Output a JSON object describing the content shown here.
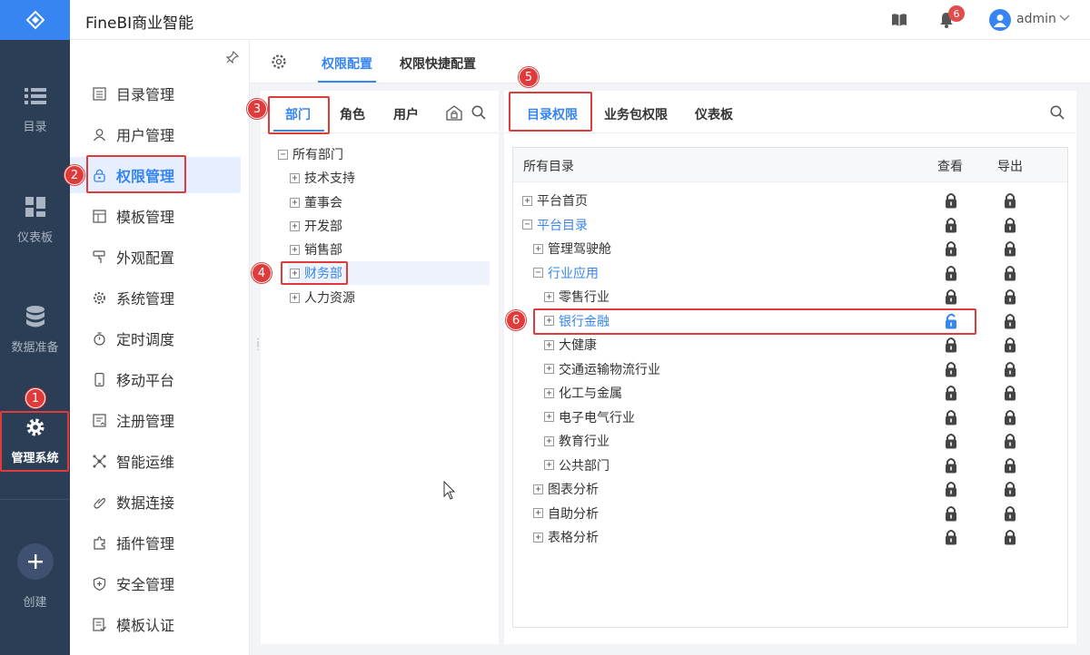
{
  "app": {
    "title": "FineBI商业智能",
    "user": "admin",
    "notification_count": "6"
  },
  "rail": {
    "items": [
      {
        "label": "目录",
        "icon": "list-icon"
      },
      {
        "label": "仪表板",
        "icon": "dashboard-icon"
      },
      {
        "label": "数据准备",
        "icon": "database-icon"
      },
      {
        "label": "管理系统",
        "icon": "gear-icon",
        "active": true
      },
      {
        "label": "创建",
        "icon": "plus-icon"
      }
    ]
  },
  "menu": {
    "items": [
      {
        "label": "目录管理",
        "icon": "catalog-icon"
      },
      {
        "label": "用户管理",
        "icon": "user-icon"
      },
      {
        "label": "权限管理",
        "icon": "lock-icon",
        "active": true
      },
      {
        "label": "模板管理",
        "icon": "template-icon"
      },
      {
        "label": "外观配置",
        "icon": "brush-icon"
      },
      {
        "label": "系统管理",
        "icon": "settings-icon"
      },
      {
        "label": "定时调度",
        "icon": "timer-icon"
      },
      {
        "label": "移动平台",
        "icon": "mobile-icon"
      },
      {
        "label": "注册管理",
        "icon": "register-icon"
      },
      {
        "label": "智能运维",
        "icon": "ops-icon"
      },
      {
        "label": "数据连接",
        "icon": "link-icon"
      },
      {
        "label": "插件管理",
        "icon": "plugin-icon"
      },
      {
        "label": "安全管理",
        "icon": "shield-icon"
      },
      {
        "label": "模板认证",
        "icon": "certify-icon"
      }
    ]
  },
  "main_tabs": [
    "权限配置",
    "权限快捷配置"
  ],
  "left_tabs": [
    "部门",
    "角色",
    "用户"
  ],
  "dept_tree": [
    {
      "label": "所有部门",
      "sign": "−"
    },
    {
      "label": "技术支持",
      "sign": "+"
    },
    {
      "label": "董事会",
      "sign": "+"
    },
    {
      "label": "开发部",
      "sign": "+"
    },
    {
      "label": "销售部",
      "sign": "+"
    },
    {
      "label": "财务部",
      "sign": "+"
    },
    {
      "label": "人力资源",
      "sign": "+"
    }
  ],
  "right_tabs": [
    "目录权限",
    "业务包权限",
    "仪表板"
  ],
  "catalog": {
    "header": {
      "name": "所有目录",
      "view": "查看",
      "export": "导出"
    },
    "rows": [
      {
        "label": "平台首页",
        "sign": "+",
        "view_unlocked": false
      },
      {
        "label": "平台目录",
        "sign": "−",
        "view_unlocked": false
      },
      {
        "label": "管理驾驶舱",
        "sign": "+",
        "view_unlocked": false
      },
      {
        "label": "行业应用",
        "sign": "−",
        "view_unlocked": false
      },
      {
        "label": "零售行业",
        "sign": "+",
        "view_unlocked": false
      },
      {
        "label": "银行金融",
        "sign": "+",
        "view_unlocked": true
      },
      {
        "label": "大健康",
        "sign": "+",
        "view_unlocked": false
      },
      {
        "label": "交通运输物流行业",
        "sign": "+",
        "view_unlocked": false
      },
      {
        "label": "化工与金属",
        "sign": "+",
        "view_unlocked": false
      },
      {
        "label": "电子电气行业",
        "sign": "+",
        "view_unlocked": false
      },
      {
        "label": "教育行业",
        "sign": "+",
        "view_unlocked": false
      },
      {
        "label": "公共部门",
        "sign": "+",
        "view_unlocked": false
      },
      {
        "label": "图表分析",
        "sign": "+",
        "view_unlocked": false
      },
      {
        "label": "自助分析",
        "sign": "+",
        "view_unlocked": false
      },
      {
        "label": "表格分析",
        "sign": "+",
        "view_unlocked": false
      }
    ]
  },
  "callouts": [
    "1",
    "2",
    "3",
    "4",
    "5",
    "6"
  ],
  "colors": {
    "accent": "#3685f2",
    "rail": "#2c3e55",
    "callout": "#e03b3b"
  }
}
